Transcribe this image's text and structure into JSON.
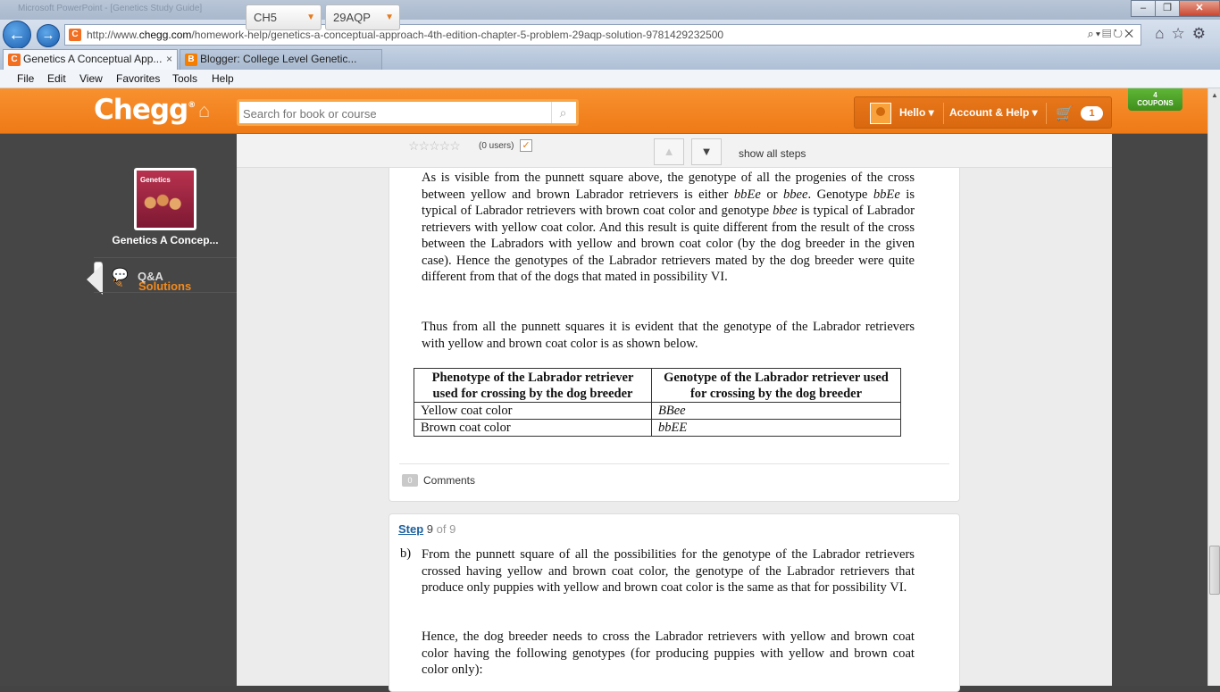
{
  "browser": {
    "titlebar_ghost": "Microsoft PowerPoint - [Genetics Study Guide]",
    "url_prefix": "http://www.",
    "url_domain": "chegg.com",
    "url_path": "/homework-help/genetics-a-conceptual-approach-4th-edition-chapter-5-problem-29aqp-solution-9781429232500",
    "tabs": [
      {
        "label": "Genetics A Conceptual App...",
        "close": "×"
      },
      {
        "label": "Blogger: College Level Genetic..."
      }
    ],
    "menu": [
      "File",
      "Edit",
      "View",
      "Favorites",
      "Tools",
      "Help"
    ],
    "win_controls": {
      "min": "–",
      "max": "❐",
      "close": "✕"
    }
  },
  "header": {
    "logo": "Chegg",
    "search_placeholder": "Search for book or course",
    "hello": "Hello ▾",
    "account": "Account & Help ▾",
    "cart_count": "1",
    "coupons_count": "4",
    "coupons_label": "COUPONS"
  },
  "sidebar": {
    "book_cover_text": "Genetics",
    "book_title": "Genetics A Concep...",
    "items": [
      {
        "label": "Solutions",
        "icon": "solutions-icon"
      },
      {
        "label": "Q&A",
        "icon": "qa-icon"
      }
    ]
  },
  "stepnav": {
    "chapter": "CH5",
    "problem": "29AQP",
    "rating_users": "(0 users)",
    "show_all": "show all steps"
  },
  "step8": {
    "p1_a": "As is visible from the punnett square above, the genotype of all the progenies of the cross between yellow and brown Labrador retrievers is either ",
    "p1_g1": "bbEe",
    "p1_b": " or ",
    "p1_g2": "bbee",
    "p1_c": ". Genotype ",
    "p1_g3": "bbEe",
    "p1_d": " is typical of Labrador retrievers with brown coat color and genotype ",
    "p1_g4": "bbee",
    "p1_e": " is typical of Labrador retrievers with yellow coat color. And this result is quite different from the result of the cross between the Labradors with yellow and brown coat color (by the dog breeder in the given case). Hence the genotypes of the Labrador retrievers mated by the dog breeder were quite different from that of the dogs that mated in possibility VI.",
    "p2": "Thus from all the punnett squares it is evident that the genotype of the Labrador retrievers with yellow and brown coat color is as shown below.",
    "table": {
      "headers": [
        "Phenotype of the Labrador retriever used for crossing by the dog breeder",
        "Genotype of the Labrador retriever used for crossing by the dog breeder"
      ],
      "rows": [
        [
          "Yellow coat color",
          "BBee"
        ],
        [
          "Brown coat color",
          "bbEE"
        ]
      ]
    },
    "comments_count": "0",
    "comments_label": "Comments"
  },
  "step9": {
    "step_word": "Step",
    "num": "9",
    "of": "of 9",
    "b_marker": "b)",
    "p1": "From the punnett square of all the possibilities for the genotype of the Labrador retrievers crossed having yellow and brown coat color, the genotype of the Labrador retrievers that produce only puppies with yellow and brown coat color is the same as that for possibility VI.",
    "p2": "Hence, the dog breeder needs to cross the Labrador retrievers with yellow and brown coat color having the following genotypes (for producing puppies with yellow and brown coat color only):"
  }
}
